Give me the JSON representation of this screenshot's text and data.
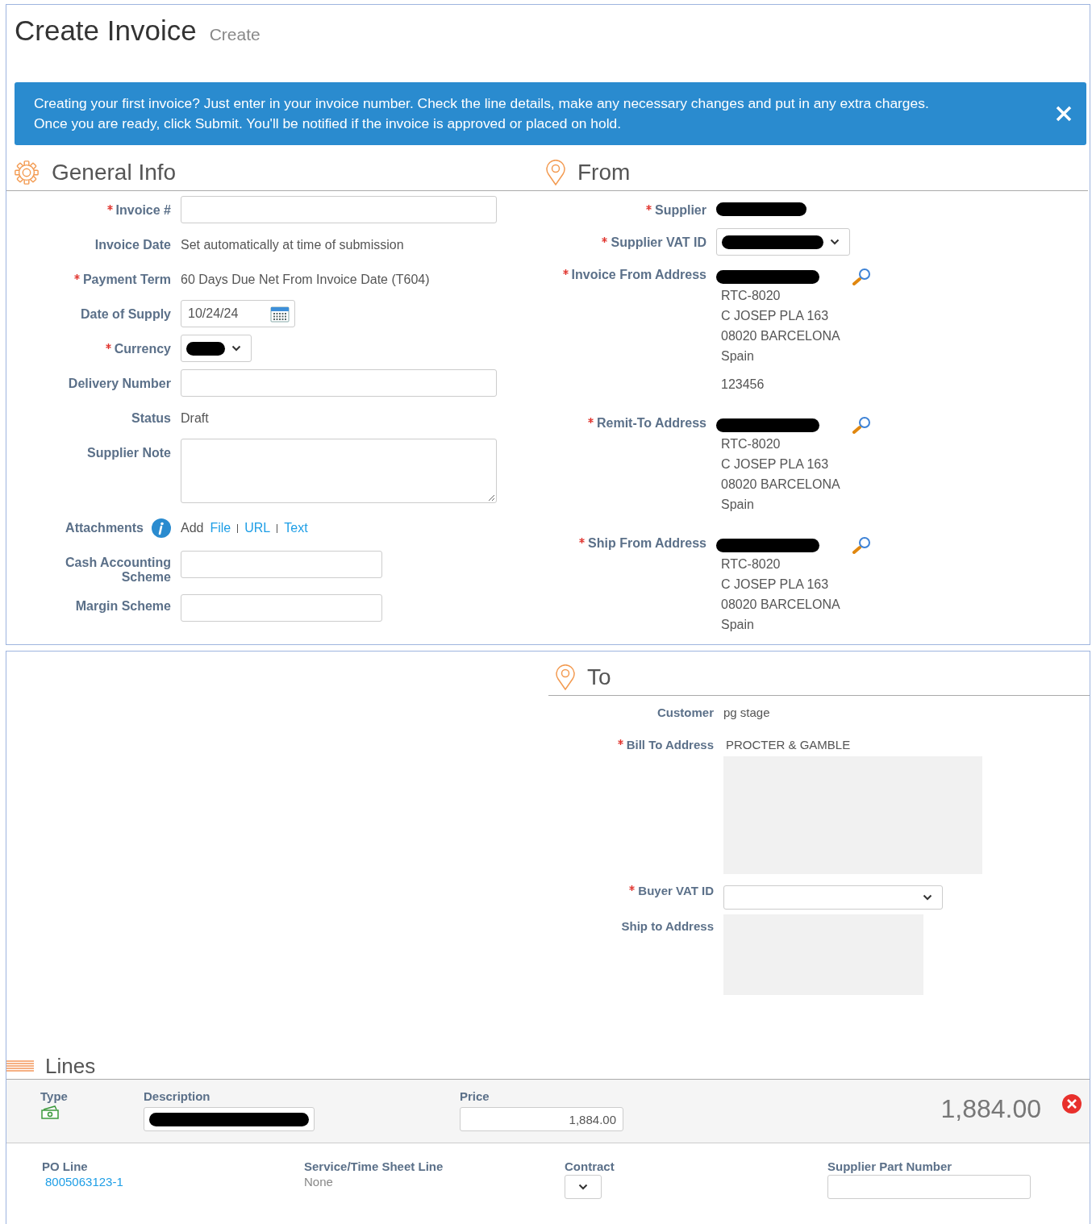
{
  "header": {
    "title": "Create Invoice",
    "subtitle": "Create"
  },
  "banner": {
    "lines": [
      "Creating your first invoice? Just enter in your invoice number. Check the line details, make any necessary changes and put in any extra charges.",
      "Once you are ready, click Submit. You'll be notified if the invoice is approved or placed on hold."
    ]
  },
  "general_info": {
    "title": "General Info",
    "fields": [
      {
        "kind": "input",
        "label": "Invoice #",
        "required": true
      },
      {
        "kind": "text",
        "label": "Invoice Date",
        "required": false,
        "value": "Set automatically at time of submission"
      },
      {
        "kind": "text",
        "label": "Payment Term",
        "required": true,
        "value": "60 Days Due Net From Invoice Date (T604)"
      },
      {
        "kind": "date",
        "label": "Date of Supply",
        "required": false,
        "value": "10/24/24"
      },
      {
        "kind": "select",
        "label": "Currency",
        "required": true,
        "redacted": true
      },
      {
        "kind": "input",
        "label": "Delivery Number",
        "required": false
      },
      {
        "kind": "text",
        "label": "Status",
        "required": false,
        "value": "Draft"
      },
      {
        "kind": "textarea",
        "label": "Supplier Note",
        "required": false
      },
      {
        "kind": "attachments",
        "label": "Attachments",
        "required": false,
        "value": "Add",
        "links": [
          "File",
          "URL",
          "Text"
        ]
      },
      {
        "kind": "short_input",
        "label": "Cash Accounting Scheme",
        "required": false
      },
      {
        "kind": "short_input",
        "label": "Margin Scheme",
        "required": false
      }
    ]
  },
  "from": {
    "title": "From",
    "fields": [
      {
        "kind": "text",
        "label": "Supplier",
        "required": true,
        "redacted": true
      },
      {
        "kind": "select",
        "label": "Supplier VAT ID",
        "required": true,
        "redacted": true
      },
      {
        "kind": "address",
        "label": "Invoice From Address",
        "required": true,
        "redacted": true,
        "lines": [
          "RTC-8020",
          "C JOSEP PLA 163",
          "08020 BARCELONA",
          "Spain"
        ],
        "extra": "123456"
      },
      {
        "kind": "address",
        "label": "Remit-To Address",
        "required": true,
        "redacted": true,
        "lines": [
          "RTC-8020",
          "C JOSEP PLA 163",
          "08020 BARCELONA",
          "Spain"
        ]
      },
      {
        "kind": "address",
        "label": "Ship From Address",
        "required": true,
        "redacted": true,
        "lines": [
          "RTC-8020",
          "C JOSEP PLA 163",
          "08020 BARCELONA",
          "Spain"
        ]
      }
    ]
  },
  "to": {
    "title": "To",
    "fields": [
      {
        "kind": "text",
        "label": "Customer",
        "required": false,
        "value": "pg stage"
      },
      {
        "kind": "masked_address",
        "label": "Bill To Address",
        "required": true,
        "value": "PROCTER & GAMBLE"
      },
      {
        "kind": "select",
        "label": "Buyer VAT ID",
        "required": true,
        "redacted": false
      },
      {
        "kind": "masked_address",
        "label": "Ship to Address",
        "required": false
      }
    ]
  },
  "lines": {
    "title": "Lines",
    "columns": [
      "Type",
      "Description",
      "Price"
    ],
    "items": [
      {
        "description_redacted": true,
        "price": "1,884.00",
        "total": "1,884.00",
        "details": [
          {
            "kind": "link",
            "label": "PO Line",
            "value": "8005063123-1"
          },
          {
            "kind": "text",
            "label": "Service/Time Sheet Line",
            "value": "None"
          },
          {
            "kind": "select",
            "label": "Contract"
          },
          {
            "kind": "input",
            "label": "Supplier Part Number"
          }
        ]
      }
    ]
  }
}
